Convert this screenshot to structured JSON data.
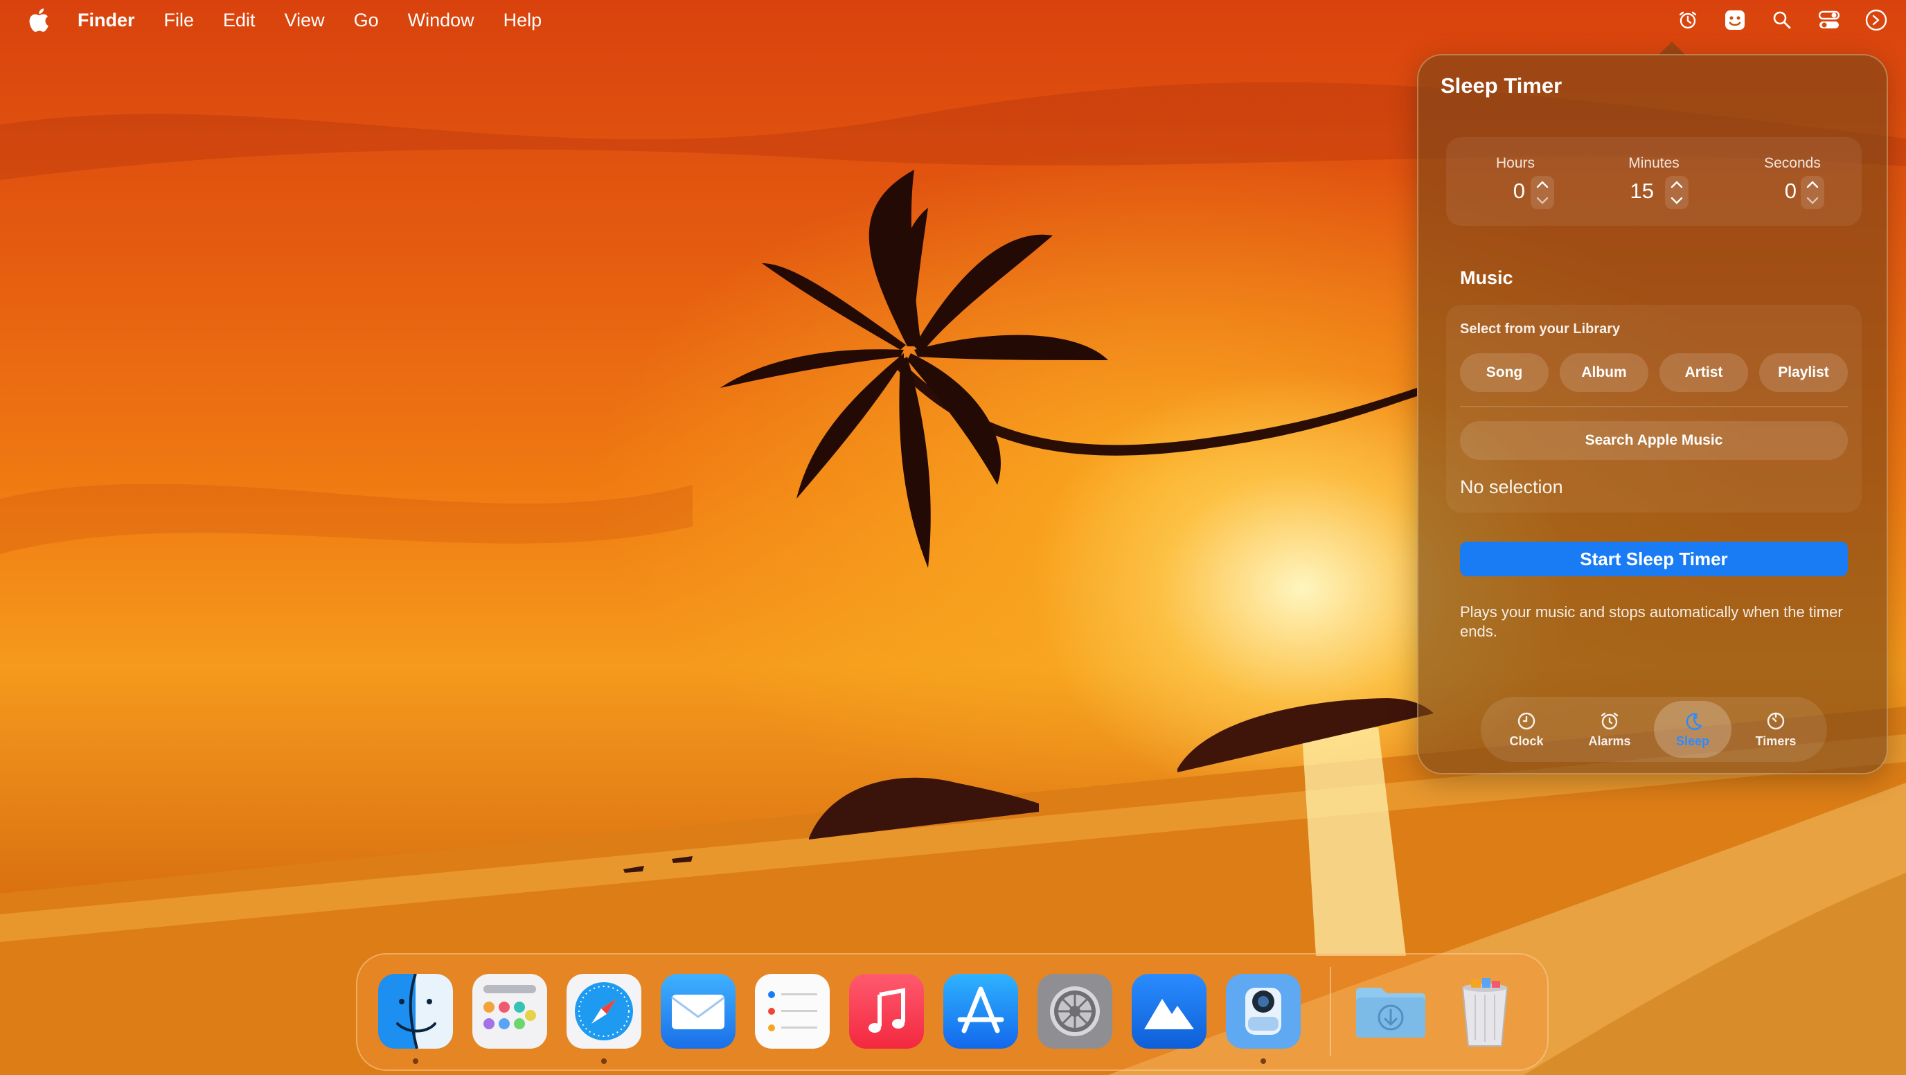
{
  "menubar": {
    "app_name": "Finder",
    "menus": [
      "File",
      "Edit",
      "View",
      "Go",
      "Window",
      "Help"
    ],
    "status_icons": [
      "alarm-clock-icon",
      "app-status-icon",
      "search-icon",
      "control-center-icon",
      "siri-icon"
    ]
  },
  "sleep_timer": {
    "title": "Sleep Timer",
    "hours_label": "Hours",
    "hours_value": "0",
    "minutes_label": "Minutes",
    "minutes_value": "15",
    "seconds_label": "Seconds",
    "seconds_value": "0",
    "music_heading": "Music",
    "library_label": "Select from your Library",
    "library_options": [
      "Song",
      "Album",
      "Artist",
      "Playlist"
    ],
    "search_button": "Search Apple Music",
    "selection_text": "No selection",
    "start_button": "Start Sleep Timer",
    "description": "Plays your music and stops automatically when the timer ends.",
    "accent_color": "#1a7cf5"
  },
  "tabs": {
    "items": [
      {
        "label": "Clock",
        "icon": "clock-icon"
      },
      {
        "label": "Alarms",
        "icon": "alarm-icon"
      },
      {
        "label": "Sleep",
        "icon": "sleep-moon-icon"
      },
      {
        "label": "Timers",
        "icon": "timer-icon"
      }
    ],
    "active": "Sleep"
  },
  "dock": {
    "apps": [
      "Finder",
      "Launchpad",
      "Safari",
      "Mail",
      "Reminders",
      "Music",
      "App Store",
      "System Settings",
      "Instruments",
      "Preview"
    ],
    "running": [
      "Finder",
      "Safari",
      "Preview"
    ],
    "folders": [
      "Downloads",
      "Trash"
    ]
  }
}
